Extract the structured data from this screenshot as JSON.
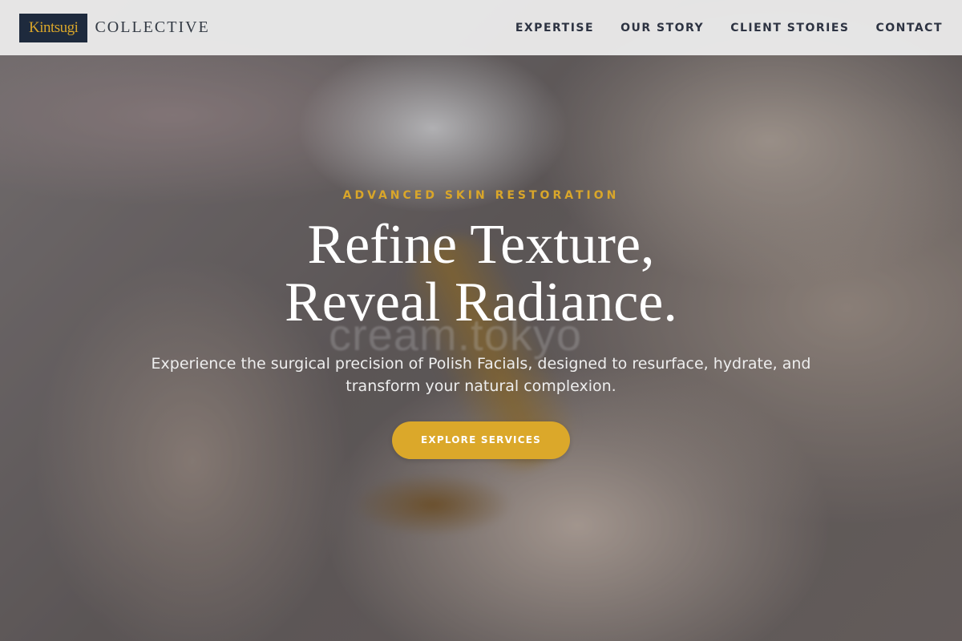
{
  "brand": {
    "mark": "Kintsugi",
    "name": "COLLECTIVE"
  },
  "nav": {
    "items": [
      {
        "label": "EXPERTISE"
      },
      {
        "label": "OUR STORY"
      },
      {
        "label": "CLIENT STORIES"
      },
      {
        "label": "CONTACT"
      }
    ]
  },
  "hero": {
    "eyebrow": "ADVANCED SKIN RESTORATION",
    "headline_line1": "Refine Texture,",
    "headline_line2": "Reveal Radiance.",
    "subtext": "Experience the surgical precision of Polish Facials, designed to resurface, hydrate, and transform your natural complexion.",
    "cta_label": "EXPLORE SERVICES",
    "watermark": "cream.tokyo"
  },
  "colors": {
    "accent_gold": "#dba82a",
    "navy": "#1e2a3d",
    "nav_text": "#2d3342"
  }
}
